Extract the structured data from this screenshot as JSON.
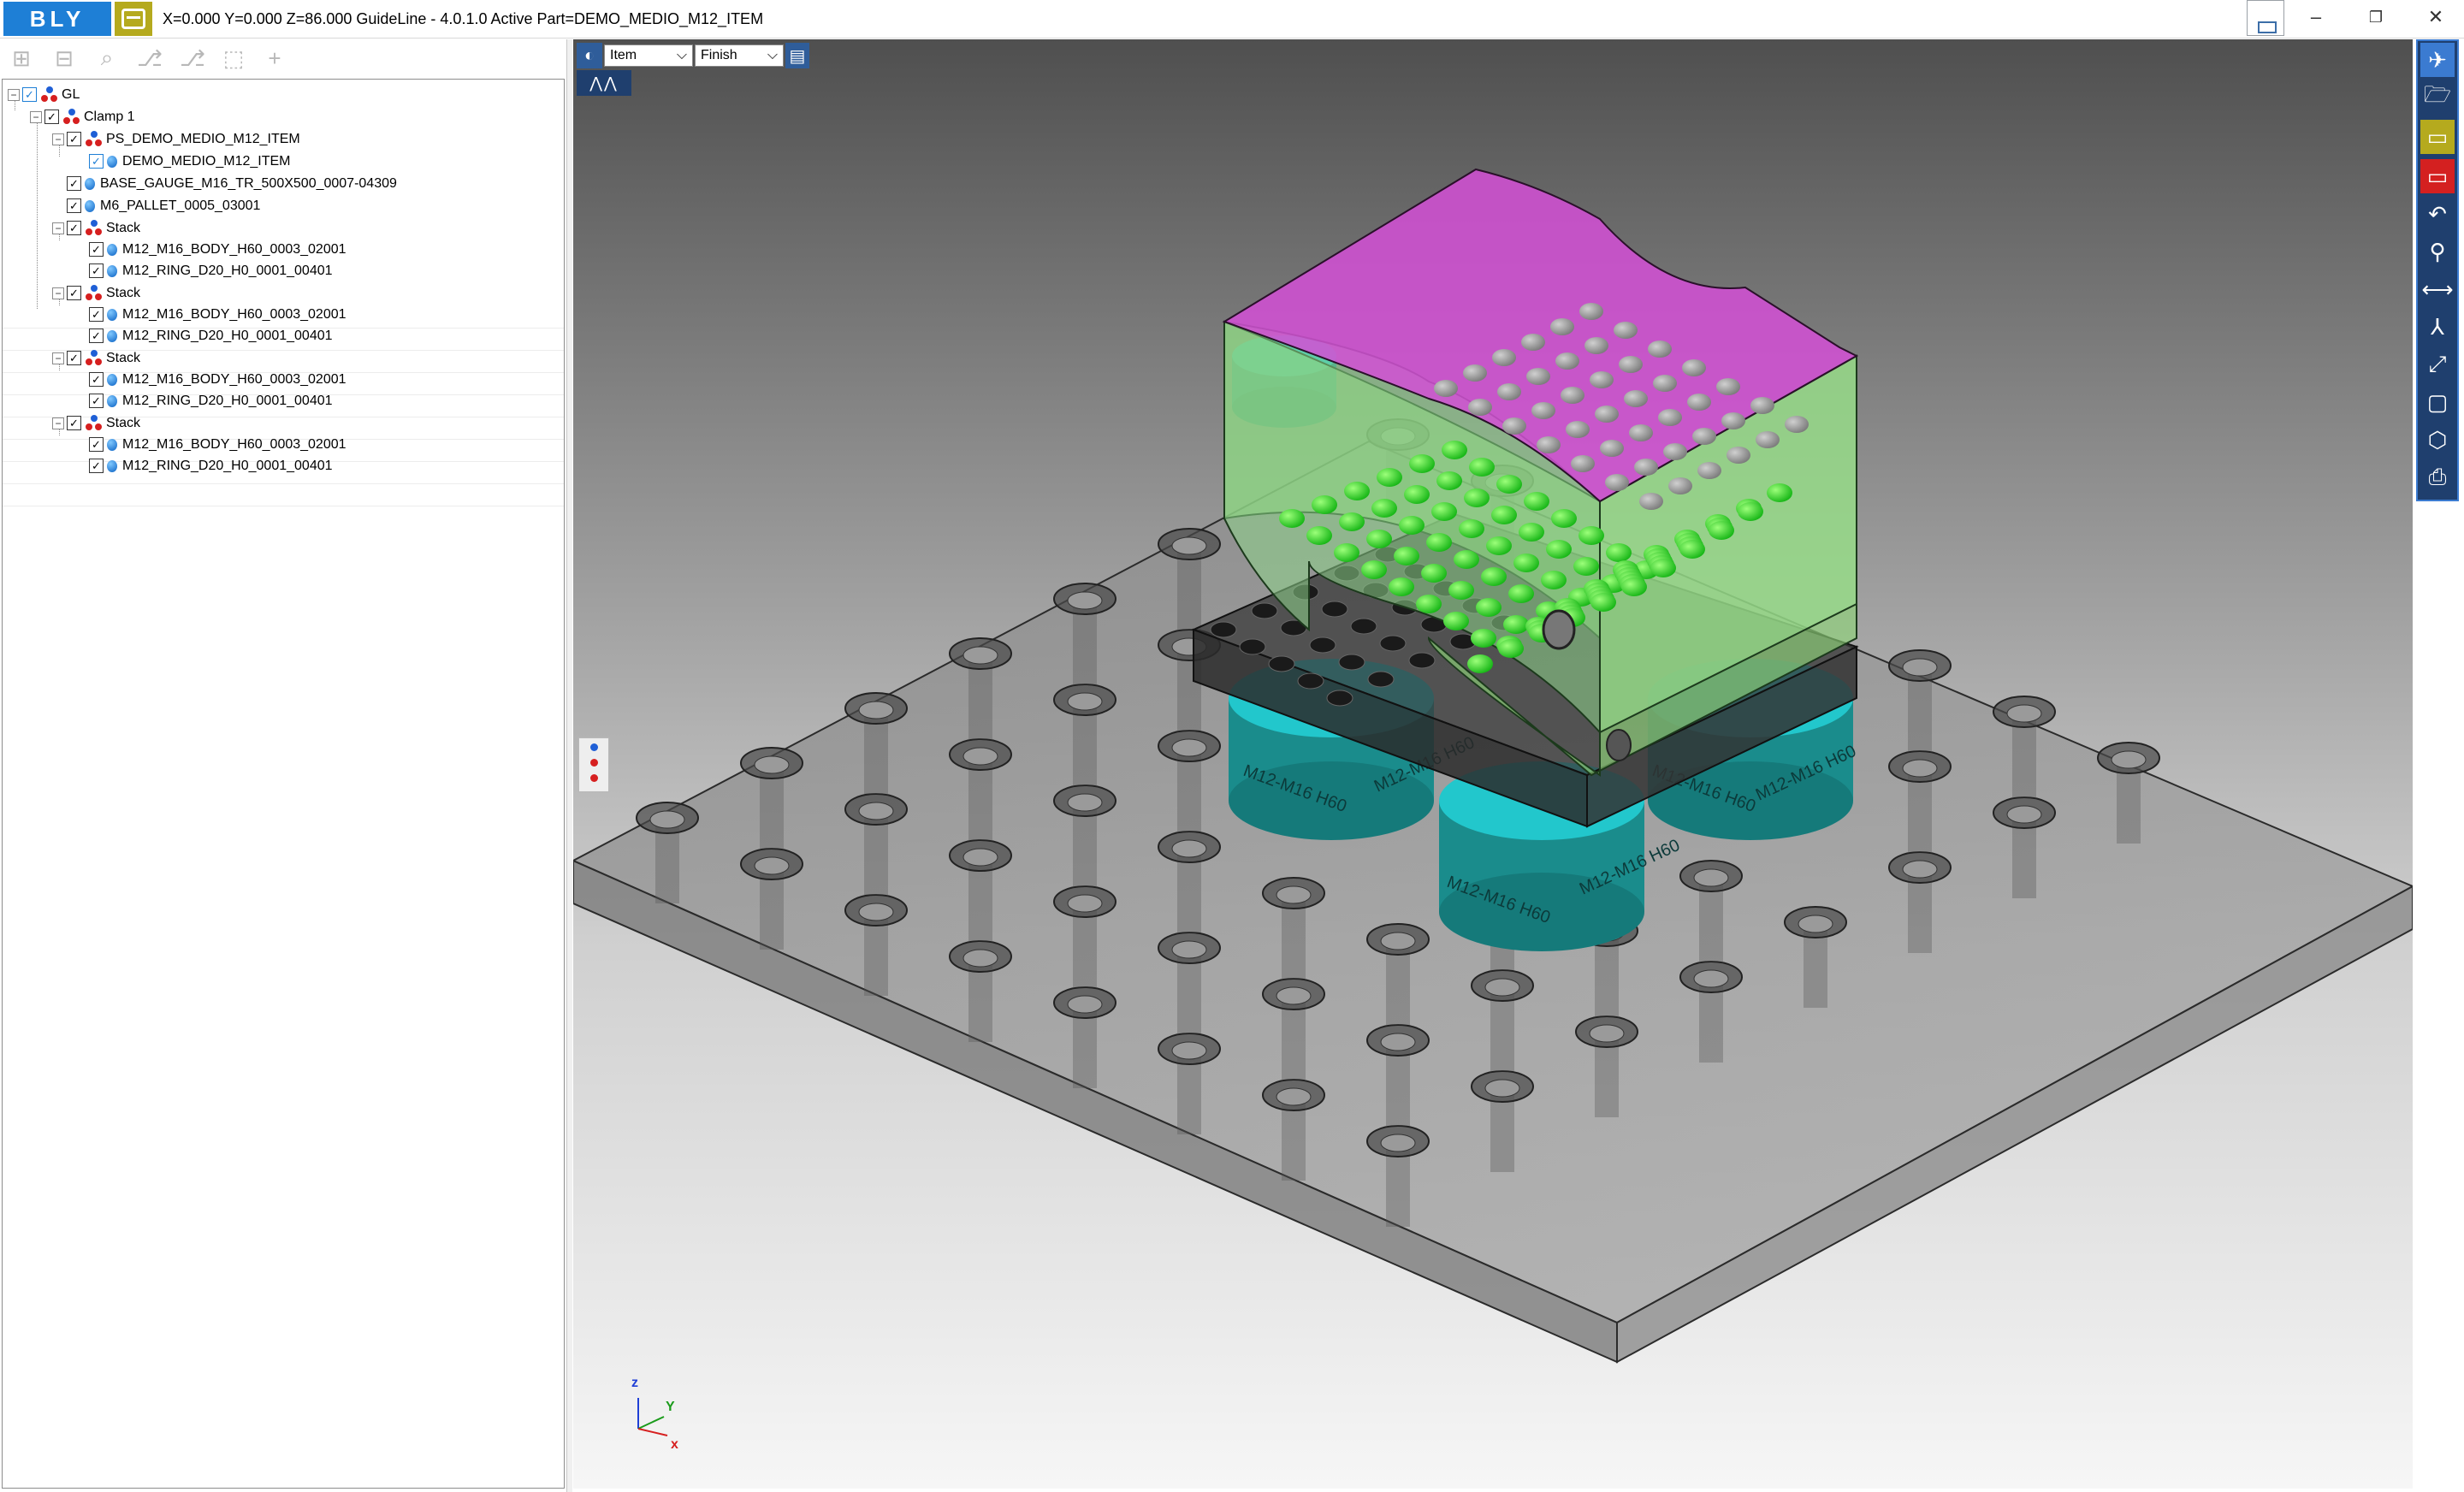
{
  "app": {
    "logo_text": "BLY",
    "title": "X=0.000 Y=0.000 Z=86.000   GuideLine - 4.0.1.0 Active Part=DEMO_MEDIO_M12_ITEM",
    "window_controls": {
      "minimize": "–",
      "maximize": "❐",
      "close": "✕"
    }
  },
  "tree_toolbar": {
    "buttons": [
      {
        "icon": "expand-all-icon",
        "glyph": "⊞"
      },
      {
        "icon": "collapse-all-icon",
        "glyph": "⊟"
      },
      {
        "icon": "search-icon",
        "glyph": "⌕"
      },
      {
        "icon": "tree-add-icon",
        "glyph": "⎇"
      },
      {
        "icon": "tree-remove-icon",
        "glyph": "⎇"
      },
      {
        "icon": "select-frame-icon",
        "glyph": "⬚"
      },
      {
        "icon": "add-icon",
        "glyph": "+"
      }
    ]
  },
  "tree": {
    "items": [
      {
        "label": "GL",
        "type": "group"
      },
      {
        "label": "Clamp 1",
        "type": "group"
      },
      {
        "label": "PS_DEMO_MEDIO_M12_ITEM",
        "type": "group"
      },
      {
        "label": "DEMO_MEDIO_M12_ITEM",
        "type": "part"
      },
      {
        "label": "BASE_GAUGE_M16_TR_500X500_0007-04309",
        "type": "part"
      },
      {
        "label": "M6_PALLET_0005_03001",
        "type": "part"
      },
      {
        "label": "Stack",
        "type": "group"
      },
      {
        "label": "M12_M16_BODY_H60_0003_02001",
        "type": "part"
      },
      {
        "label": "M12_RING_D20_H0_0001_00401",
        "type": "part"
      },
      {
        "label": "Stack",
        "type": "group"
      },
      {
        "label": "M12_M16_BODY_H60_0003_02001",
        "type": "part"
      },
      {
        "label": "M12_RING_D20_H0_0001_00401",
        "type": "part"
      },
      {
        "label": "Stack",
        "type": "group"
      },
      {
        "label": "M12_M16_BODY_H60_0003_02001",
        "type": "part"
      },
      {
        "label": "M12_RING_D20_H0_0001_00401",
        "type": "part"
      },
      {
        "label": "Stack",
        "type": "group"
      },
      {
        "label": "M12_M16_BODY_H60_0003_02001",
        "type": "part"
      },
      {
        "label": "M12_RING_D20_H0_0001_00401",
        "type": "part"
      }
    ],
    "expander_collapse_glyph": "−",
    "check_glyph": "✓"
  },
  "viewport": {
    "mode_select": "Item",
    "finish_select": "Finish",
    "dropdown_glyph": "⌵",
    "axes": {
      "z": "z",
      "y": "Y",
      "x": "x"
    },
    "clamp_labels": [
      "M12-M16 H60",
      "M12-M16 H60",
      "M12-M16 H60",
      "M12-M16 H60",
      "M12-M16 H60",
      "M12-M16 H60"
    ],
    "colors": {
      "pallet": "#6a6a6a",
      "workpiece_top": "#d44fd6",
      "workpiece_body": "#8fd47a",
      "grip_points": "#2fd12f",
      "clamp_ring": "#22c7cc",
      "clamp_body": "#1a8c8c"
    }
  },
  "right_toolbar": {
    "icons": [
      "pin-icon",
      "open-folder-icon",
      "bly-yellow-icon",
      "bly-red-icon",
      "undo-icon",
      "lightbulb-icon",
      "measure-icon",
      "axes-icon",
      "fit-view-icon",
      "box-view-icon",
      "iso-view-icon",
      "print-icon"
    ],
    "glyphs": [
      "✈",
      "🗁",
      "▭",
      "▭",
      "↶",
      "⚲",
      "⟷",
      "⅄",
      "⤢",
      "▢",
      "⬡",
      "⎙"
    ]
  },
  "accent_colors": {
    "bly_blue": "#1e7fd6",
    "bly_yellow": "#b5aa1e",
    "bly_red": "#d42020",
    "toolbar_navy": "#1f3f6e"
  }
}
